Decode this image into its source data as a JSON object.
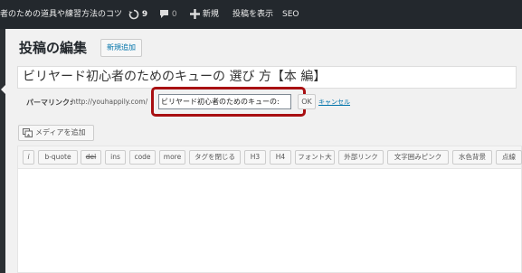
{
  "admin_bar": {
    "site_name": "者のための道具や練習方法のコツ",
    "updates_count": "9",
    "comments_count": "0",
    "new_label": "新規",
    "view_post_label": "投稿を表示",
    "seo_label": "SEO",
    "background": "#23282d"
  },
  "page": {
    "title": "投稿の編集",
    "add_new_label": "新規追加"
  },
  "post": {
    "title_value": "ビリヤード初心者のためのキューの 選び 方【本 編】"
  },
  "permalink": {
    "label": "パーマリンク:",
    "base_url": "http://youhappily.com/",
    "slug_value": "ビリヤード初心者のためのキューの:",
    "ok_label": "OK",
    "cancel_label": "キャンセル",
    "highlight_color": "#a80f12"
  },
  "media": {
    "add_media_label": "メディアを追加",
    "icon": "media-icon"
  },
  "quicktags": {
    "buttons": [
      "i",
      "b-quote",
      "del",
      "ins",
      "code",
      "more",
      "タグを閉じる",
      "H3",
      "H4",
      "フォント大",
      "外部リンク",
      "文字囲みピンク",
      "水色背景",
      "点線"
    ]
  },
  "colors": {
    "link": "#0073aa",
    "accent_red": "#a80f12"
  }
}
